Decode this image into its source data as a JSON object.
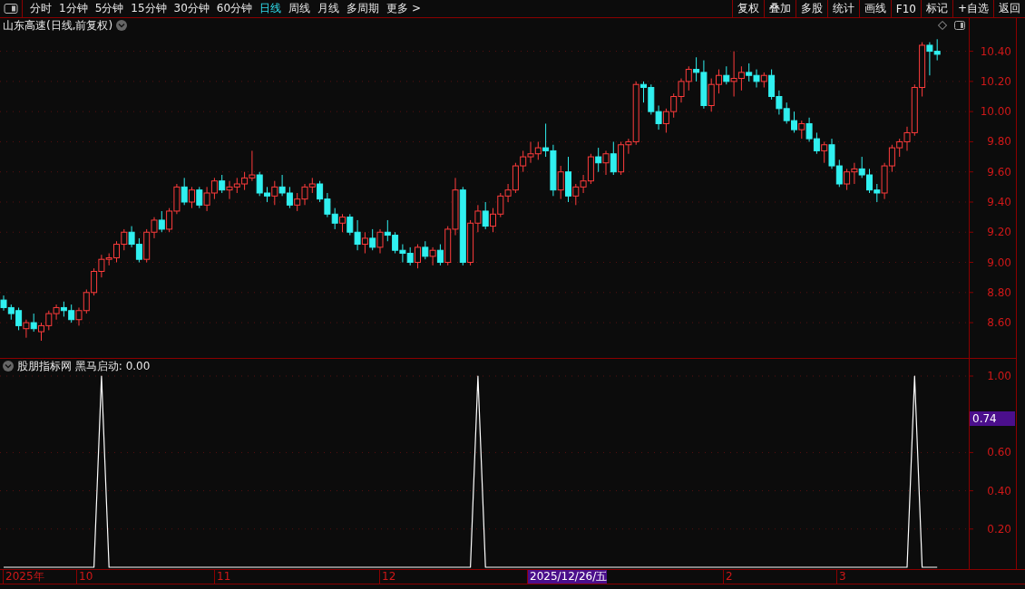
{
  "period_tabs": [
    {
      "label": "分时",
      "selected": false
    },
    {
      "label": "1分钟",
      "selected": false
    },
    {
      "label": "5分钟",
      "selected": false
    },
    {
      "label": "15分钟",
      "selected": false
    },
    {
      "label": "30分钟",
      "selected": false
    },
    {
      "label": "60分钟",
      "selected": false
    },
    {
      "label": "日线",
      "selected": true
    },
    {
      "label": "周线",
      "selected": false
    },
    {
      "label": "月线",
      "selected": false
    },
    {
      "label": "多周期",
      "selected": false
    },
    {
      "label": "更多 >",
      "selected": false
    }
  ],
  "toolbar_buttons": [
    "复权",
    "叠加",
    "多股",
    "统计",
    "画线",
    "F10",
    "标记",
    "+自选",
    "返回"
  ],
  "main_chart": {
    "title": "山东高速(日线,前复权)",
    "chart_data": {
      "type": "candlestick",
      "grid": true,
      "ylim": [
        8.36,
        10.62
      ],
      "yticks": [
        {
          "value": 10.4,
          "label": "10.40"
        },
        {
          "value": 10.2,
          "label": "10.20"
        },
        {
          "value": 10.0,
          "label": "10.00"
        },
        {
          "value": 9.8,
          "label": "9.80"
        },
        {
          "value": 9.6,
          "label": "9.60"
        },
        {
          "value": 9.4,
          "label": "9.40"
        },
        {
          "value": 9.2,
          "label": "9.20"
        },
        {
          "value": 9.0,
          "label": "9.00"
        },
        {
          "value": 8.8,
          "label": "8.80"
        },
        {
          "value": 8.6,
          "label": "8.60"
        }
      ],
      "ohlc": [
        [
          8.75,
          8.78,
          8.68,
          8.7
        ],
        [
          8.7,
          8.72,
          8.62,
          8.66
        ],
        [
          8.68,
          8.7,
          8.55,
          8.58
        ],
        [
          8.56,
          8.62,
          8.5,
          8.6
        ],
        [
          8.6,
          8.66,
          8.54,
          8.56
        ],
        [
          8.54,
          8.6,
          8.48,
          8.58
        ],
        [
          8.58,
          8.68,
          8.55,
          8.66
        ],
        [
          8.66,
          8.72,
          8.62,
          8.7
        ],
        [
          8.7,
          8.74,
          8.64,
          8.68
        ],
        [
          8.68,
          8.72,
          8.6,
          8.62
        ],
        [
          8.62,
          8.7,
          8.58,
          8.68
        ],
        [
          8.68,
          8.82,
          8.66,
          8.8
        ],
        [
          8.8,
          8.96,
          8.78,
          8.94
        ],
        [
          8.94,
          9.05,
          8.9,
          9.02
        ],
        [
          9.02,
          9.06,
          8.98,
          9.03
        ],
        [
          9.03,
          9.14,
          9.0,
          9.12
        ],
        [
          9.12,
          9.22,
          9.08,
          9.2
        ],
        [
          9.2,
          9.24,
          9.1,
          9.12
        ],
        [
          9.12,
          9.16,
          9.0,
          9.02
        ],
        [
          9.02,
          9.22,
          9.0,
          9.2
        ],
        [
          9.2,
          9.3,
          9.16,
          9.28
        ],
        [
          9.28,
          9.34,
          9.2,
          9.22
        ],
        [
          9.22,
          9.36,
          9.2,
          9.34
        ],
        [
          9.34,
          9.52,
          9.32,
          9.5
        ],
        [
          9.5,
          9.56,
          9.38,
          9.4
        ],
        [
          9.4,
          9.5,
          9.36,
          9.48
        ],
        [
          9.48,
          9.5,
          9.36,
          9.38
        ],
        [
          9.38,
          9.5,
          9.34,
          9.46
        ],
        [
          9.46,
          9.56,
          9.42,
          9.54
        ],
        [
          9.54,
          9.58,
          9.46,
          9.48
        ],
        [
          9.48,
          9.54,
          9.42,
          9.5
        ],
        [
          9.5,
          9.56,
          9.46,
          9.52
        ],
        [
          9.52,
          9.6,
          9.48,
          9.56
        ],
        [
          9.56,
          9.74,
          9.54,
          9.58
        ],
        [
          9.58,
          9.6,
          9.44,
          9.46
        ],
        [
          9.46,
          9.5,
          9.4,
          9.44
        ],
        [
          9.44,
          9.54,
          9.38,
          9.5
        ],
        [
          9.5,
          9.58,
          9.44,
          9.46
        ],
        [
          9.46,
          9.5,
          9.36,
          9.38
        ],
        [
          9.38,
          9.46,
          9.34,
          9.42
        ],
        [
          9.42,
          9.52,
          9.38,
          9.5
        ],
        [
          9.5,
          9.56,
          9.46,
          9.52
        ],
        [
          9.52,
          9.54,
          9.4,
          9.42
        ],
        [
          9.42,
          9.46,
          9.3,
          9.32
        ],
        [
          9.32,
          9.36,
          9.22,
          9.26
        ],
        [
          9.26,
          9.32,
          9.2,
          9.3
        ],
        [
          9.3,
          9.32,
          9.18,
          9.2
        ],
        [
          9.2,
          9.28,
          9.08,
          9.12
        ],
        [
          9.12,
          9.2,
          9.06,
          9.16
        ],
        [
          9.16,
          9.22,
          9.08,
          9.1
        ],
        [
          9.1,
          9.22,
          9.06,
          9.2
        ],
        [
          9.2,
          9.28,
          9.14,
          9.18
        ],
        [
          9.18,
          9.2,
          9.06,
          9.08
        ],
        [
          9.08,
          9.12,
          9.0,
          9.06
        ],
        [
          9.06,
          9.1,
          8.98,
          9.0
        ],
        [
          9.0,
          9.12,
          8.96,
          9.1
        ],
        [
          9.1,
          9.14,
          9.02,
          9.04
        ],
        [
          9.04,
          9.1,
          8.98,
          9.08
        ],
        [
          9.08,
          9.12,
          8.98,
          9.0
        ],
        [
          9.0,
          9.24,
          8.98,
          9.22
        ],
        [
          9.22,
          9.56,
          9.18,
          9.48
        ],
        [
          9.48,
          9.5,
          8.98,
          9.0
        ],
        [
          9.0,
          9.28,
          8.98,
          9.26
        ],
        [
          9.26,
          9.38,
          9.2,
          9.34
        ],
        [
          9.34,
          9.4,
          9.22,
          9.24
        ],
        [
          9.24,
          9.36,
          9.2,
          9.32
        ],
        [
          9.32,
          9.46,
          9.3,
          9.44
        ],
        [
          9.44,
          9.52,
          9.4,
          9.48
        ],
        [
          9.48,
          9.66,
          9.46,
          9.64
        ],
        [
          9.64,
          9.74,
          9.6,
          9.7
        ],
        [
          9.7,
          9.8,
          9.66,
          9.72
        ],
        [
          9.72,
          9.8,
          9.68,
          9.76
        ],
        [
          9.76,
          9.92,
          9.7,
          9.74
        ],
        [
          9.74,
          9.78,
          9.44,
          9.48
        ],
        [
          9.48,
          9.64,
          9.42,
          9.6
        ],
        [
          9.6,
          9.7,
          9.4,
          9.44
        ],
        [
          9.44,
          9.52,
          9.38,
          9.5
        ],
        [
          9.5,
          9.58,
          9.46,
          9.54
        ],
        [
          9.54,
          9.72,
          9.52,
          9.7
        ],
        [
          9.7,
          9.76,
          9.6,
          9.66
        ],
        [
          9.66,
          9.74,
          9.58,
          9.72
        ],
        [
          9.72,
          9.8,
          9.58,
          9.6
        ],
        [
          9.6,
          9.8,
          9.58,
          9.78
        ],
        [
          9.78,
          9.82,
          9.72,
          9.8
        ],
        [
          9.8,
          10.2,
          9.78,
          10.18
        ],
        [
          10.18,
          10.2,
          10.06,
          10.16
        ],
        [
          10.16,
          10.18,
          9.98,
          10.0
        ],
        [
          10.0,
          10.04,
          9.88,
          9.92
        ],
        [
          9.92,
          10.02,
          9.86,
          10.0
        ],
        [
          10.0,
          10.12,
          9.96,
          10.1
        ],
        [
          10.1,
          10.22,
          10.06,
          10.2
        ],
        [
          10.2,
          10.3,
          10.14,
          10.28
        ],
        [
          10.28,
          10.36,
          10.2,
          10.26
        ],
        [
          10.26,
          10.34,
          10.02,
          10.04
        ],
        [
          10.04,
          10.22,
          10.0,
          10.18
        ],
        [
          10.18,
          10.28,
          10.12,
          10.24
        ],
        [
          10.24,
          10.3,
          10.18,
          10.2
        ],
        [
          10.2,
          10.4,
          10.1,
          10.22
        ],
        [
          10.22,
          10.3,
          10.14,
          10.26
        ],
        [
          10.26,
          10.32,
          10.2,
          10.24
        ],
        [
          10.24,
          10.28,
          10.16,
          10.2
        ],
        [
          10.2,
          10.26,
          10.16,
          10.24
        ],
        [
          10.24,
          10.28,
          10.08,
          10.1
        ],
        [
          10.1,
          10.14,
          9.98,
          10.02
        ],
        [
          10.02,
          10.06,
          9.92,
          9.94
        ],
        [
          9.94,
          10.0,
          9.86,
          9.88
        ],
        [
          9.88,
          9.94,
          9.82,
          9.92
        ],
        [
          9.92,
          9.96,
          9.8,
          9.82
        ],
        [
          9.82,
          9.86,
          9.72,
          9.74
        ],
        [
          9.74,
          9.8,
          9.66,
          9.78
        ],
        [
          9.78,
          9.82,
          9.62,
          9.64
        ],
        [
          9.64,
          9.68,
          9.5,
          9.52
        ],
        [
          9.52,
          9.62,
          9.48,
          9.6
        ],
        [
          9.6,
          9.66,
          9.52,
          9.62
        ],
        [
          9.62,
          9.7,
          9.56,
          9.58
        ],
        [
          9.58,
          9.62,
          9.46,
          9.48
        ],
        [
          9.48,
          9.52,
          9.4,
          9.46
        ],
        [
          9.46,
          9.66,
          9.42,
          9.64
        ],
        [
          9.64,
          9.78,
          9.6,
          9.76
        ],
        [
          9.76,
          9.82,
          9.7,
          9.8
        ],
        [
          9.8,
          9.9,
          9.74,
          9.86
        ],
        [
          9.86,
          10.18,
          9.84,
          10.16
        ],
        [
          10.16,
          10.46,
          10.1,
          10.44
        ],
        [
          10.44,
          10.46,
          10.24,
          10.4
        ],
        [
          10.4,
          10.48,
          10.34,
          10.38
        ]
      ]
    }
  },
  "indicator_panel": {
    "title": "股朋指标网 黑马启动: 0.00",
    "chart_data": {
      "type": "line",
      "ylim": [
        0,
        1
      ],
      "grid": true,
      "yticks": [
        {
          "value": 1.0,
          "label": "1.00"
        },
        {
          "value": 0.6,
          "label": "0.60"
        },
        {
          "value": 0.4,
          "label": "0.40"
        },
        {
          "value": 0.2,
          "label": "0.20"
        }
      ],
      "series": [
        {
          "color": "#ffffff",
          "values": [
            0,
            0,
            0,
            0,
            0,
            0,
            0,
            0,
            0,
            0,
            0,
            0,
            0,
            1,
            0,
            0,
            0,
            0,
            0,
            0,
            0,
            0,
            0,
            0,
            0,
            0,
            0,
            0,
            0,
            0,
            0,
            0,
            0,
            0,
            0,
            0,
            0,
            0,
            0,
            0,
            0,
            0,
            0,
            0,
            0,
            0,
            0,
            0,
            0,
            0,
            0,
            0,
            0,
            0,
            0,
            0,
            0,
            0,
            0,
            0,
            0,
            0,
            0,
            1,
            0,
            0,
            0,
            0,
            0,
            0,
            0,
            0,
            0,
            0,
            0,
            0,
            0,
            0,
            0,
            0,
            0,
            0,
            0,
            0,
            0,
            0,
            0,
            0,
            0,
            0,
            0,
            0,
            0,
            0,
            0,
            0,
            0,
            0,
            0,
            0,
            0,
            0,
            0,
            0,
            0,
            0,
            0,
            0,
            0,
            0,
            0,
            0,
            0,
            0,
            0,
            0,
            0,
            0,
            0,
            0,
            0,
            1,
            0,
            0,
            0
          ]
        }
      ]
    },
    "crosshair_value": "0.74"
  },
  "date_axis": [
    {
      "label": "2025年",
      "highlighted": false
    },
    {
      "label": "10",
      "highlighted": false
    },
    {
      "label": "11",
      "highlighted": false
    },
    {
      "label": "12",
      "highlighted": false
    },
    {
      "label": "2025/12/26/五",
      "highlighted": true
    },
    {
      "label": "2",
      "highlighted": false
    },
    {
      "label": "3",
      "highlighted": false
    }
  ]
}
